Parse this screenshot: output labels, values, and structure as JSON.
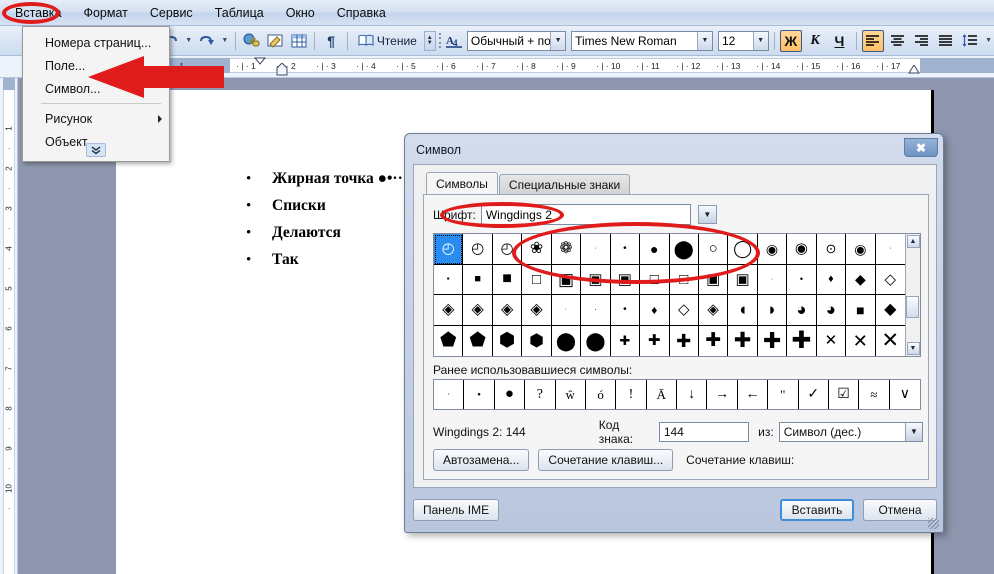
{
  "app": {
    "menubar": [
      {
        "label": "Вставка",
        "accel": "В",
        "active": true
      },
      {
        "label": "Формат",
        "accel": "м"
      },
      {
        "label": "Сервис",
        "accel": "е"
      },
      {
        "label": "Таблица",
        "accel": "Т"
      },
      {
        "label": "Окно",
        "accel": "О"
      },
      {
        "label": "Справка",
        "accel": "С"
      }
    ]
  },
  "toolbar": {
    "undo_icon": "undo-icon",
    "redo_icon": "redo-icon",
    "hyperlink_icon": "hyperlink-icon",
    "drawing_icon": "drawing-icon",
    "table_icon": "insert-table-icon",
    "pilcrow_icon": "show-formatting-icon",
    "reading_label": "Чтение",
    "reading_accel": "Ч",
    "style_icon": "style-icon",
    "style_value": "Обычный + полуж",
    "font_value": "Times New Roman",
    "size_value": "12",
    "bold_label": "Ж",
    "italic_label": "К",
    "underline_label": "Ч",
    "align_left_icon": "align-left-icon",
    "align_center_icon": "align-center-icon",
    "align_right_icon": "align-right-icon",
    "align_justify_icon": "align-justify-icon",
    "line_spacing_icon": "line-spacing-icon"
  },
  "ruler": {
    "horizontal_ticks": [
      "1",
      "1",
      "2",
      "3",
      "4",
      "5",
      "6",
      "7",
      "8",
      "9",
      "10",
      "11",
      "12",
      "13",
      "14",
      "15",
      "16",
      "17"
    ],
    "vertical_ticks": [
      "1",
      "2",
      "3",
      "4",
      "5",
      "6",
      "7",
      "8",
      "9",
      "10"
    ],
    "left_indent_marker": "indent-marker",
    "tab_marker": "tab-marker"
  },
  "insert_menu": {
    "items": [
      {
        "label": "Номера страниц...",
        "accel": "о",
        "submenu": false
      },
      {
        "label": "Поле...",
        "accel": "П",
        "submenu": false
      },
      {
        "label": "Символ...",
        "accel": "и",
        "submenu": false
      },
      {
        "separator": true
      },
      {
        "label": "Рисунок",
        "accel": "Р",
        "submenu": true
      },
      {
        "label": "Объект...",
        "accel": "ъ",
        "submenu": false
      }
    ],
    "expand_label": "»"
  },
  "document": {
    "bullets": [
      {
        "marker": "•",
        "text": "Жирная точка ",
        "suffix": "●•··",
        "bold": true
      },
      {
        "marker": "•",
        "text": "Списки",
        "bold": true
      },
      {
        "marker": "•",
        "text": "Делаются",
        "bold": true
      },
      {
        "marker": "•",
        "text": "Так",
        "bold": true
      }
    ]
  },
  "dialog": {
    "title": "Символ",
    "close_label": "✖",
    "tabs": [
      {
        "label": "Символы",
        "accel": "С",
        "active": true
      },
      {
        "label": "Специальные знаки",
        "accel": "п",
        "active": false
      }
    ],
    "font_label": "Шрифт:",
    "font_accel": "Ш",
    "font_value": "Wingdings 2",
    "grid_rows": [
      [
        "◴",
        "◴",
        "◴",
        "❀",
        "❁",
        "·",
        "•",
        "●",
        "⬤",
        "○",
        "◯",
        "◉",
        "◉",
        "⊙",
        "◉",
        "·"
      ],
      [
        "▪",
        "■",
        "■",
        "□",
        "▣",
        "▣",
        "▣",
        "□",
        "□",
        "▣",
        "▣",
        "·",
        "•",
        "♦",
        "◆",
        "◇"
      ],
      [
        "◈",
        "◈",
        "◈",
        "◈",
        "·",
        "·",
        "•",
        "♦",
        "◇",
        "◈",
        "◖",
        "◗",
        "◕",
        "◕",
        "■",
        "◆"
      ],
      [
        "⬟",
        "⬟",
        "⬢",
        "⬢",
        "⬤",
        "⬤",
        "✚",
        "✚",
        "✚",
        "✚",
        "✚",
        "✚",
        "✚",
        "✕",
        "✕",
        "✕"
      ]
    ],
    "selected_index": 0,
    "recent_label": "Ранее использовавшиеся символы:",
    "recent_accel": "Р",
    "recent_symbols": [
      "·",
      "•",
      "●",
      "?",
      "ŵ",
      "ó",
      "!",
      "Ā",
      "↓",
      "→",
      "←",
      "\"",
      "✓",
      "☑",
      "≈",
      "∨"
    ],
    "char_info": "Wingdings 2: 144",
    "code_label": "Код знака:",
    "code_accel": "К",
    "code_value": "144",
    "from_label": "из:",
    "from_value": "Символ (дес.)",
    "autocorrect_button": "Автозамена...",
    "autocorrect_accel": "т",
    "shortcut_button": "Сочетание клавиш...",
    "shortcut_accel": "ч",
    "shortcut_label": "Сочетание клавиш:",
    "ime_button": "Панель IME",
    "ime_accel": "П",
    "insert_button": "Вставить",
    "insert_accel": "а",
    "cancel_button": "Отмена"
  },
  "annotations": {
    "accent_color": "#e01b1b",
    "ellipse_menu_item": "вставка-menu-highlight",
    "arrow": "red-arrow-pointing-to-symbol-item",
    "ellipse_font": "font-field-highlight",
    "ellipse_symbols": "circle-symbols-highlight"
  },
  "colors": {
    "desktop": "#8d96ae",
    "page": "#ffffff",
    "accent": "#e01b1b",
    "selection": "#2b8cf0"
  }
}
